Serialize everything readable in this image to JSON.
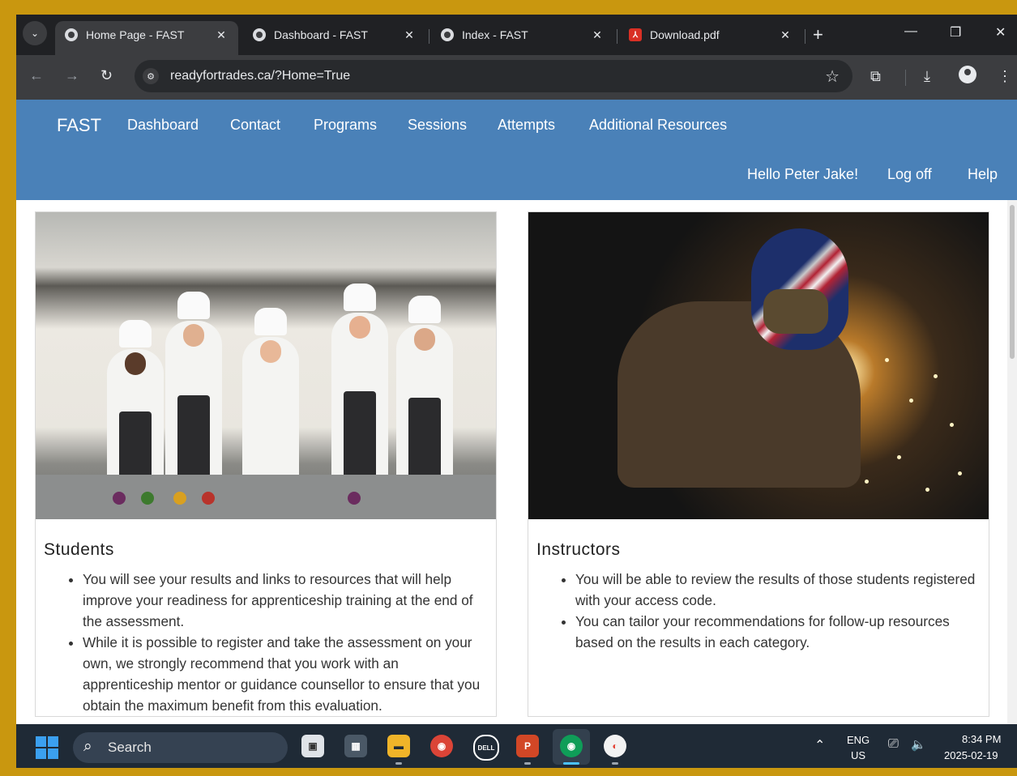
{
  "browser": {
    "tabs": [
      {
        "title": "Home Page - FAST",
        "icon": "globe-icon",
        "active": true
      },
      {
        "title": "Dashboard - FAST",
        "icon": "globe-icon",
        "active": false
      },
      {
        "title": "Index - FAST",
        "icon": "globe-icon",
        "active": false
      },
      {
        "title": "Download.pdf",
        "icon": "pdf-icon",
        "active": false
      }
    ],
    "url": "readyfortrades.ca/?Home=True"
  },
  "site": {
    "brand": "FAST",
    "nav": [
      "Dashboard",
      "Contact",
      "Programs",
      "Sessions",
      "Attempts",
      "Additional Resources"
    ],
    "greeting": "Hello Peter Jake!",
    "logoff": "Log off",
    "help": "Help",
    "accent_color": "#4a81b8"
  },
  "cards": [
    {
      "title": "Students",
      "image": "kitchen-chefs-photo",
      "bullets": [
        "You will see your results and links to resources that will help improve your readiness for apprenticeship training at the end of the assessment.",
        "While it is possible to register and take the assessment on your own, we strongly recommend that you work with an apprenticeship mentor or guidance counsellor to ensure that you obtain the maximum benefit from this evaluation."
      ]
    },
    {
      "title": "Instructors",
      "image": "welder-photo",
      "bullets": [
        "You will be able to review the results of those students registered with your access code.",
        "You can tailor your recommendations for follow-up resources based on the results in each category."
      ]
    }
  ],
  "taskbar": {
    "search_label": "Search",
    "language": "ENG",
    "region": "US",
    "time": "8:34 PM",
    "date": "2025-02-19"
  }
}
